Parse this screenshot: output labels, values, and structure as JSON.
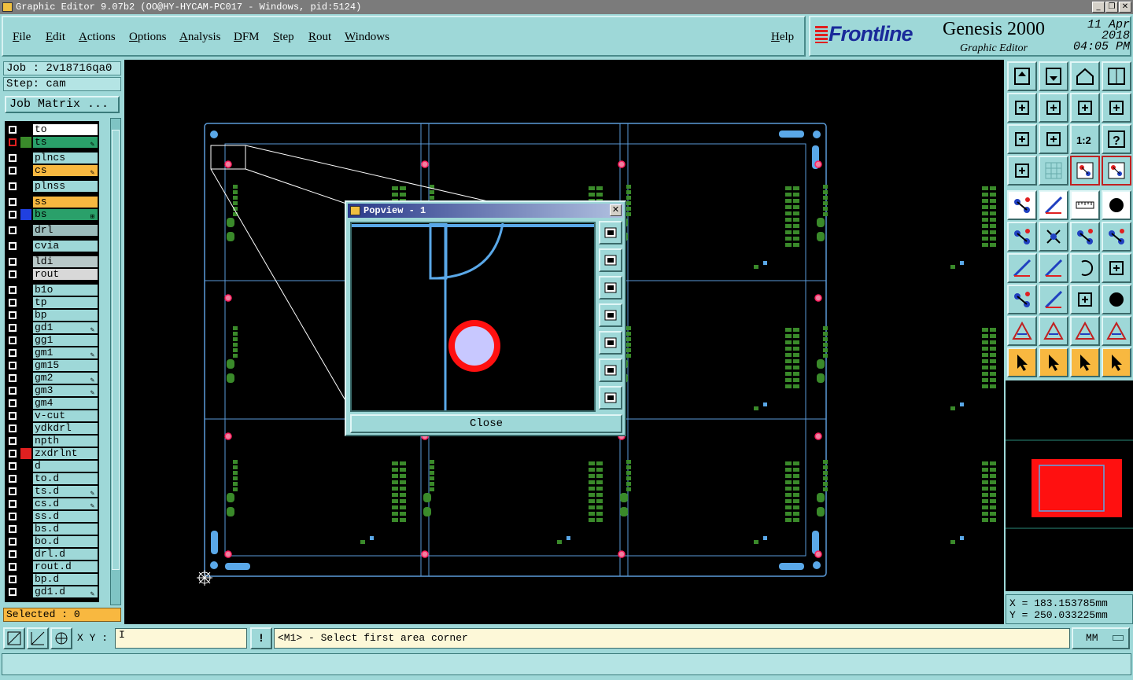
{
  "window": {
    "title": "Graphic Editor 9.07b2 (OO@HY-HYCAM-PC017 - Windows, pid:5124)",
    "controls": [
      "minimize",
      "maximize",
      "close"
    ]
  },
  "menu": {
    "items": [
      "File",
      "Edit",
      "Actions",
      "Options",
      "Analysis",
      "DFM",
      "Step",
      "Rout",
      "Windows"
    ],
    "help": "Help"
  },
  "brand": {
    "logo": "Frontline",
    "product": "Genesis 2000",
    "subtitle": "Graphic Editor",
    "date": "11 Apr 2018",
    "time": "04:05 PM"
  },
  "job": {
    "job_label": "Job : 2v18716qa0",
    "step_label": "Step: cam",
    "matrix_button": "Job Matrix ...",
    "selected": "Selected : 0"
  },
  "layers": [
    {
      "name": "to",
      "color": "#000000",
      "bg": "#ffffff",
      "mark": ""
    },
    {
      "name": "ts",
      "color": "#3a8a2a",
      "bg": "#2aa06a",
      "mark": "✎",
      "checked": "red"
    },
    {
      "name": "plncs",
      "color": "#000000",
      "bg": "#9ed8d8",
      "mark": ""
    },
    {
      "name": "cs",
      "color": "#000000",
      "bg": "#f8b840",
      "mark": "✎"
    },
    {
      "name": "plnss",
      "color": "#000000",
      "bg": "#9ed8d8",
      "mark": ""
    },
    {
      "name": "ss",
      "color": "#000000",
      "bg": "#f8b840",
      "mark": ""
    },
    {
      "name": "bs",
      "color": "#2040e0",
      "bg": "#2aa06a",
      "mark": "⊞"
    },
    {
      "name": "drl",
      "color": "#000000",
      "bg": "#9cbcbc",
      "mark": ""
    },
    {
      "name": "cvia",
      "color": "#000000",
      "bg": "#9ed8d8",
      "mark": ""
    },
    {
      "name": "ldi",
      "color": "#000000",
      "bg": "#b8c8c8",
      "mark": ""
    },
    {
      "name": "rout",
      "color": "#000000",
      "bg": "#d8d8d8",
      "mark": ""
    },
    {
      "name": "b1o",
      "color": "#000000",
      "bg": "#9ed8d8",
      "mark": ""
    },
    {
      "name": "tp",
      "color": "#000000",
      "bg": "#9ed8d8",
      "mark": ""
    },
    {
      "name": "bp",
      "color": "#000000",
      "bg": "#9ed8d8",
      "mark": ""
    },
    {
      "name": "gd1",
      "color": "#000000",
      "bg": "#9ed8d8",
      "mark": "✎"
    },
    {
      "name": "gg1",
      "color": "#000000",
      "bg": "#9ed8d8",
      "mark": ""
    },
    {
      "name": "gm1",
      "color": "#000000",
      "bg": "#9ed8d8",
      "mark": "✎"
    },
    {
      "name": "gm15",
      "color": "#000000",
      "bg": "#9ed8d8",
      "mark": ""
    },
    {
      "name": "gm2",
      "color": "#000000",
      "bg": "#9ed8d8",
      "mark": "✎"
    },
    {
      "name": "gm3",
      "color": "#000000",
      "bg": "#9ed8d8",
      "mark": "✎"
    },
    {
      "name": "gm4",
      "color": "#000000",
      "bg": "#9ed8d8",
      "mark": ""
    },
    {
      "name": "v-cut",
      "color": "#000000",
      "bg": "#9ed8d8",
      "mark": ""
    },
    {
      "name": "ydkdrl",
      "color": "#000000",
      "bg": "#9ed8d8",
      "mark": ""
    },
    {
      "name": "npth",
      "color": "#000000",
      "bg": "#9ed8d8",
      "mark": ""
    },
    {
      "name": "zxdrlnt",
      "color": "#e02020",
      "bg": "#9ed8d8",
      "mark": ""
    },
    {
      "name": "d",
      "color": "#000000",
      "bg": "#9ed8d8",
      "mark": ""
    },
    {
      "name": "to.d",
      "color": "#000000",
      "bg": "#9ed8d8",
      "mark": ""
    },
    {
      "name": "ts.d",
      "color": "#000000",
      "bg": "#9ed8d8",
      "mark": "✎"
    },
    {
      "name": "cs.d",
      "color": "#000000",
      "bg": "#9ed8d8",
      "mark": "✎"
    },
    {
      "name": "ss.d",
      "color": "#000000",
      "bg": "#9ed8d8",
      "mark": ""
    },
    {
      "name": "bs.d",
      "color": "#000000",
      "bg": "#9ed8d8",
      "mark": ""
    },
    {
      "name": "bo.d",
      "color": "#000000",
      "bg": "#9ed8d8",
      "mark": ""
    },
    {
      "name": "drl.d",
      "color": "#000000",
      "bg": "#9ed8d8",
      "mark": ""
    },
    {
      "name": "rout.d",
      "color": "#000000",
      "bg": "#9ed8d8",
      "mark": ""
    },
    {
      "name": "bp.d",
      "color": "#000000",
      "bg": "#9ed8d8",
      "mark": ""
    },
    {
      "name": "gd1.d",
      "color": "#000000",
      "bg": "#9ed8d8",
      "mark": "✎"
    }
  ],
  "popview": {
    "title": "Popview - 1",
    "close_label": "Close",
    "side_buttons": [
      "zoom-fit-icon",
      "pan-up-icon",
      "pan-down-icon",
      "pan-left-icon",
      "pan-right-icon",
      "zoom-out-icon",
      "zoom-in-icon"
    ]
  },
  "toolbar": {
    "icons": [
      "zoom-home-icon",
      "zoom-down-icon",
      "home-icon",
      "window-icon",
      "pan-left-icon",
      "pan-right-icon",
      "swap-icon",
      "route-icon",
      "fit-icon",
      "zoom-area-icon",
      "scale-1-2-icon",
      "help-icon",
      "settings-icon",
      "grid-icon",
      "layers-red-icon",
      "layers-blue-icon",
      "snap-pad-icon",
      "line-draw-icon",
      "measure-icon",
      "fill-circle-icon",
      "connect-nodes-icon",
      "cross-icon",
      "pad-to-pad-icon",
      "pad-arrow-icon",
      "angle-icon",
      "line-icon",
      "arc-icon",
      "align-icon",
      "pad-dim-icon",
      "line-red-icon",
      "box-dim-icon",
      "circles-icon",
      "triangle-icon",
      "triangle-a-icon",
      "triangle-a-red-icon",
      "triangle-x-icon",
      "select-icon",
      "select-box-icon",
      "select-arrow-icon",
      "select-net-icon"
    ]
  },
  "coords": {
    "x": "X = 183.153785mm",
    "y": "Y = 250.033225mm"
  },
  "bottom": {
    "xy_label": "X Y :",
    "xy_value": "I",
    "message": "<M1> - Select first area corner",
    "units": "MM"
  },
  "colors": {
    "panel": "#9ed8d8",
    "canvas": "#000000",
    "outline": "#5a9ad8",
    "pad_green": "#3a8a2a",
    "pad_pink": "#f080a0",
    "selected": "#f8b840"
  }
}
